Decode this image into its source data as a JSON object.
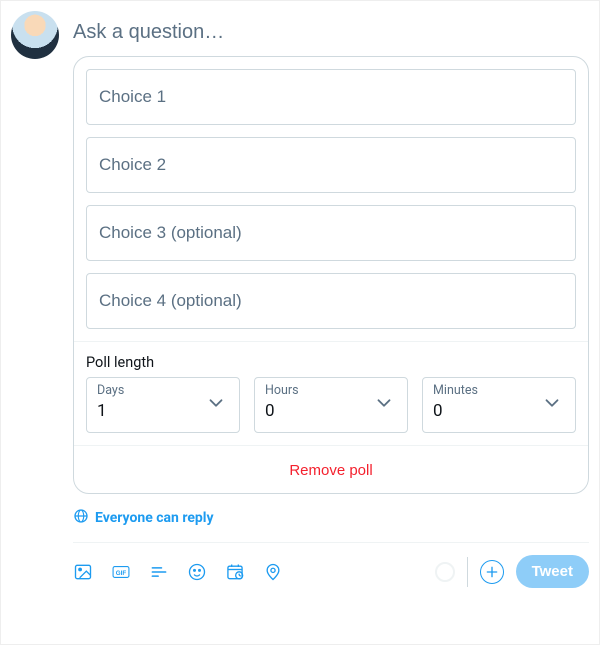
{
  "composer": {
    "question_placeholder": "Ask a question…"
  },
  "poll": {
    "choices": [
      {
        "placeholder": "Choice 1",
        "value": ""
      },
      {
        "placeholder": "Choice 2",
        "value": ""
      },
      {
        "placeholder": "Choice 3 (optional)",
        "value": ""
      },
      {
        "placeholder": "Choice 4 (optional)",
        "value": ""
      }
    ],
    "length_label": "Poll length",
    "days": {
      "label": "Days",
      "value": "1"
    },
    "hours": {
      "label": "Hours",
      "value": "0"
    },
    "minutes": {
      "label": "Minutes",
      "value": "0"
    },
    "remove_label": "Remove poll"
  },
  "reply": {
    "label": "Everyone can reply"
  },
  "toolbar": {
    "tweet_label": "Tweet"
  }
}
